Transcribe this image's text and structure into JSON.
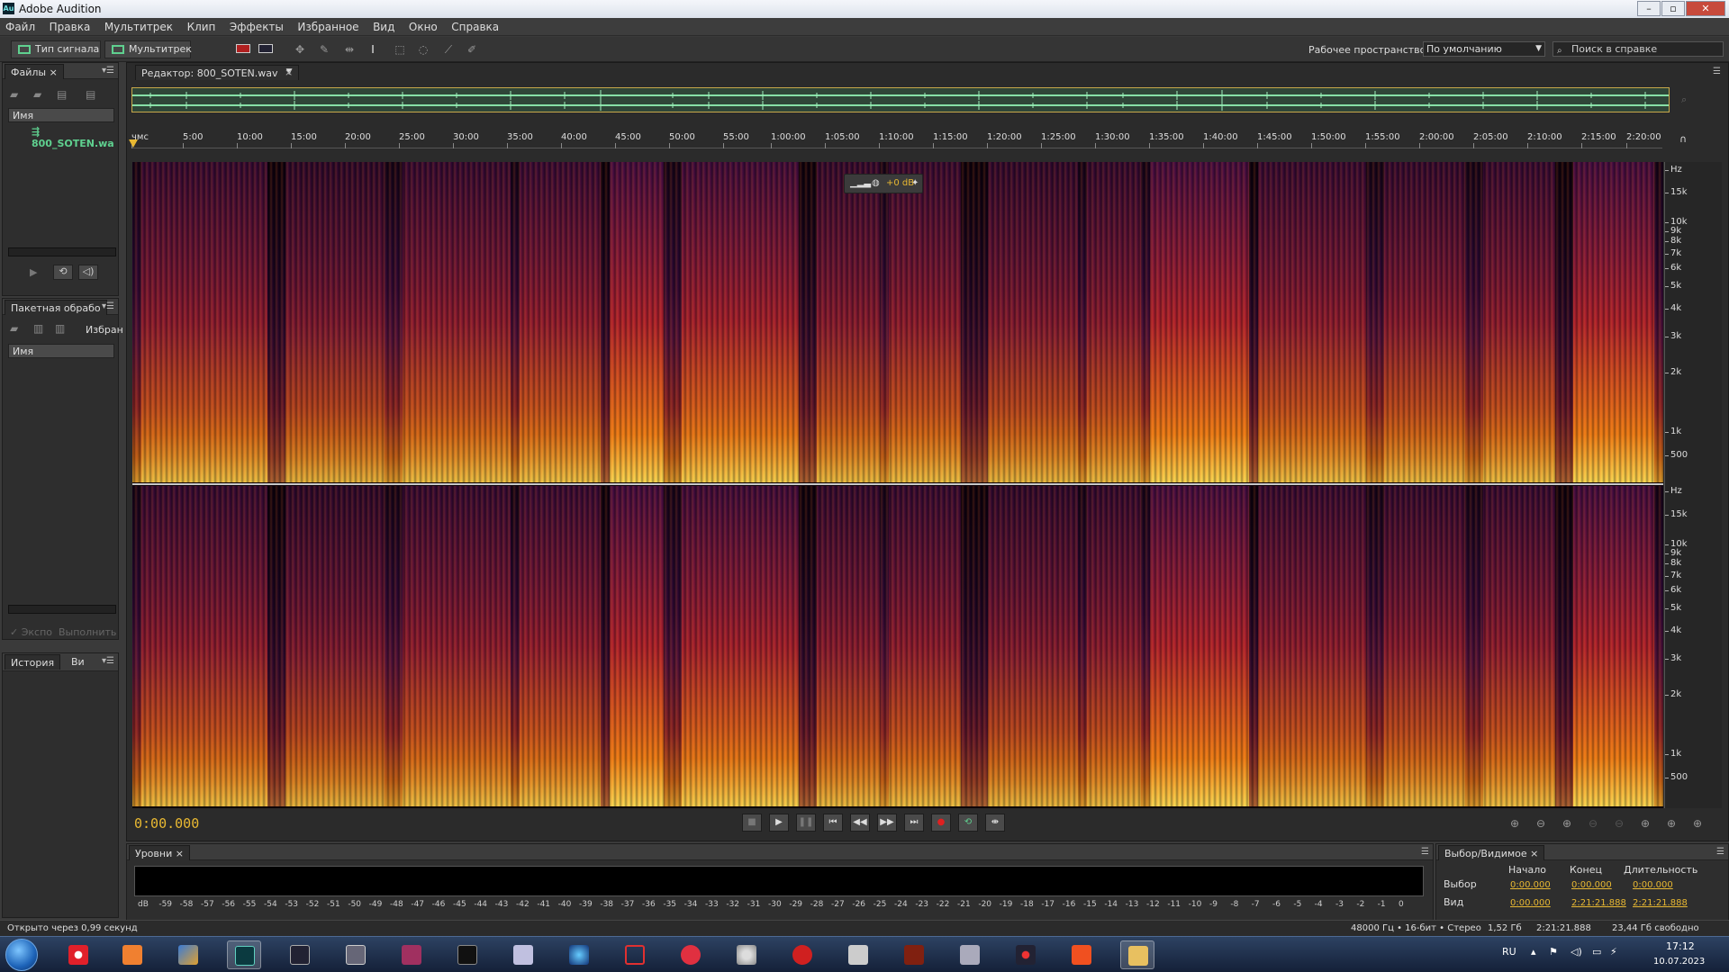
{
  "window": {
    "title": "Adobe Audition",
    "app_icon": "Au"
  },
  "menu": [
    "Файл",
    "Правка",
    "Мультитрек",
    "Клип",
    "Эффекты",
    "Избранное",
    "Вид",
    "Окно",
    "Справка"
  ],
  "toolbar": {
    "waveform_button": "Тип сигнала",
    "multitrack_button": "Мультитрек",
    "workspace_label": "Рабочее пространство:",
    "workspace_value": "По умолчанию",
    "help_search": "Поиск в справке"
  },
  "files_panel": {
    "tab": "Файлы",
    "col_name": "Имя",
    "file": "800_SOTEN.wa"
  },
  "batch_panel": {
    "tab": "Пакетная обрабо",
    "favorites": "Избран",
    "col_name": "Имя",
    "export_label": "Экспо",
    "run_label": "Выполнить"
  },
  "history_panel": {
    "tab": "История",
    "tab2": "Ви"
  },
  "editor": {
    "tab": "Редактор: 800_SOTEN.wav",
    "time": "0:00.000",
    "hud_gain": "+0 dB",
    "ruler_ticks": [
      "чмс",
      "5:00",
      "10:00",
      "15:00",
      "20:00",
      "25:00",
      "30:00",
      "35:00",
      "40:00",
      "45:00",
      "50:00",
      "55:00",
      "1:00:00",
      "1:05:00",
      "1:10:00",
      "1:15:00",
      "1:20:00",
      "1:25:00",
      "1:30:00",
      "1:35:00",
      "1:40:00",
      "1:45:00",
      "1:50:00",
      "1:55:00",
      "2:00:00",
      "2:05:00",
      "2:10:00",
      "2:15:00",
      "2:20:00"
    ],
    "hz_labels": [
      "Hz",
      "15k",
      "10k",
      "9k",
      "8k",
      "7k",
      "6k",
      "5k",
      "4k",
      "3k",
      "2k",
      "1k",
      "500"
    ]
  },
  "levels_panel": {
    "tab": "Уровни",
    "db_ticks": [
      "dB",
      "-59",
      "-58",
      "-57",
      "-56",
      "-55",
      "-54",
      "-53",
      "-52",
      "-51",
      "-50",
      "-49",
      "-48",
      "-47",
      "-46",
      "-45",
      "-44",
      "-43",
      "-42",
      "-41",
      "-40",
      "-39",
      "-38",
      "-37",
      "-36",
      "-35",
      "-34",
      "-33",
      "-32",
      "-31",
      "-30",
      "-29",
      "-28",
      "-27",
      "-26",
      "-25",
      "-24",
      "-23",
      "-22",
      "-21",
      "-20",
      "-19",
      "-18",
      "-17",
      "-16",
      "-15",
      "-14",
      "-13",
      "-12",
      "-11",
      "-10",
      "-9",
      "-8",
      "-7",
      "-6",
      "-5",
      "-4",
      "-3",
      "-2",
      "-1",
      "0"
    ]
  },
  "selection_view": {
    "tab": "Выбор/Видимое",
    "col_start": "Начало",
    "col_end": "Конец",
    "col_duration": "Длительность",
    "row_selection": "Выбор",
    "row_view": "Вид",
    "sel_start": "0:00.000",
    "sel_end": "0:00.000",
    "sel_duration": "0:00.000",
    "view_start": "0:00.000",
    "view_end": "2:21:21.888",
    "view_duration": "2:21:21.888"
  },
  "status": {
    "left": "Открыто через 0,99 секунд",
    "format": "48000 Гц • 16-бит • Стерео",
    "size": "1,52 Гб",
    "duration": "2:21:21.888",
    "free": "23,44 Гб свободно"
  },
  "taskbar": {
    "lang": "RU",
    "time": "17:12",
    "date": "10.07.2023"
  }
}
